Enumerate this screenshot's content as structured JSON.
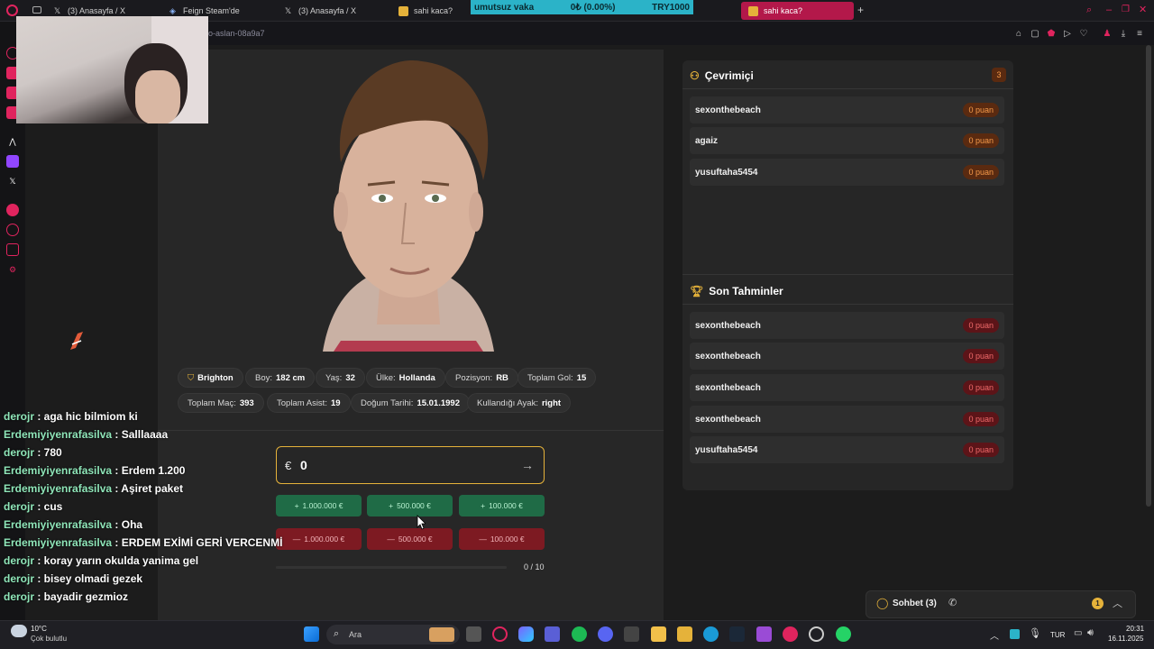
{
  "browser": {
    "tabs": [
      {
        "label": "(3) Anasayfa / X",
        "icon": "x-icon"
      },
      {
        "label": "Feign Steam'de",
        "icon": "steam-icon"
      },
      {
        "label": "(3) Anasayfa / X",
        "icon": "x-icon"
      },
      {
        "label": "sahi kaca?",
        "icon": "site-icon"
      },
      {
        "label": "sahi kaca?",
        "icon": "site-icon",
        "active": true
      }
    ],
    "url_fragment": "o-aslan-08a9a7",
    "accent": "#b3184a"
  },
  "ticker": {
    "name": "umutsuz vaka",
    "change": "0₺ (0.00%)",
    "total": "TRY1000",
    "color": "#2bb3c8"
  },
  "player": {
    "club": "Brighton",
    "height": {
      "label": "Boy:",
      "value": "182 cm"
    },
    "age": {
      "label": "Yaş:",
      "value": "32"
    },
    "country": {
      "label": "Ülke:",
      "value": "Hollanda"
    },
    "position": {
      "label": "Pozisyon:",
      "value": "RB"
    },
    "goals": {
      "label": "Toplam Gol:",
      "value": "15"
    },
    "matches": {
      "label": "Toplam Maç:",
      "value": "393"
    },
    "assists": {
      "label": "Toplam Asist:",
      "value": "19"
    },
    "birthdate": {
      "label": "Doğum Tarihi:",
      "value": "15.01.1992"
    },
    "foot": {
      "label": "Kullandığı Ayak:",
      "value": "right"
    }
  },
  "guess": {
    "currency": "€",
    "value": "0",
    "plus_buttons": [
      "1.000.000 €",
      "500.000 €",
      "100.000 €"
    ],
    "minus_buttons": [
      "1.000.000 €",
      "500.000 €",
      "100.000 €"
    ],
    "progress_text": "0 / 10",
    "progress_fraction": 0,
    "accent": "#e5b23a"
  },
  "online": {
    "title": "Çevrimiçi",
    "count": "3",
    "users": [
      {
        "name": "sexonthebeach",
        "score": "0 puan"
      },
      {
        "name": "agaiz",
        "score": "0 puan"
      },
      {
        "name": "yusuftaha5454",
        "score": "0 puan"
      }
    ]
  },
  "recent": {
    "title": "Son Tahminler",
    "items": [
      {
        "name": "sexonthebeach",
        "score": "0 puan"
      },
      {
        "name": "sexonthebeach",
        "score": "0 puan"
      },
      {
        "name": "sexonthebeach",
        "score": "0 puan"
      },
      {
        "name": "sexonthebeach",
        "score": "0 puan"
      },
      {
        "name": "yusuftaha5454",
        "score": "0 puan"
      }
    ]
  },
  "chat_widget": {
    "label": "Sohbet (3)",
    "badge": "1"
  },
  "stream_chat": [
    {
      "user": "derojr",
      "msg": " : aga hic bilmiom ki"
    },
    {
      "user": "Erdemiyiyenrafasilva",
      "msg": " : Salllaaaa"
    },
    {
      "user": "derojr",
      "msg": " : 780"
    },
    {
      "user": "Erdemiyiyenrafasilva",
      "msg": " : Erdem 1.200"
    },
    {
      "user": "Erdemiyiyenrafasilva",
      "msg": " : Aşiret paket"
    },
    {
      "user": "derojr",
      "msg": " : cus"
    },
    {
      "user": "Erdemiyiyenrafasilva",
      "msg": " : Oha"
    },
    {
      "user": "Erdemiyiyenrafasilva",
      "msg": " : ERDEM EXİMİ GERİ VERCENMİ"
    },
    {
      "user": "derojr",
      "msg": " : koray yarın okulda yanima gel"
    },
    {
      "user": "derojr",
      "msg": " : bisey olmadi gezek"
    },
    {
      "user": "derojr",
      "msg": " : bayadir gezmioz"
    }
  ],
  "taskbar": {
    "weather_temp": "10°C",
    "weather_desc": "Çok bulutlu",
    "search_placeholder": "Ara",
    "lang": "TUR",
    "time": "20:31",
    "date": "16.11.2025"
  }
}
